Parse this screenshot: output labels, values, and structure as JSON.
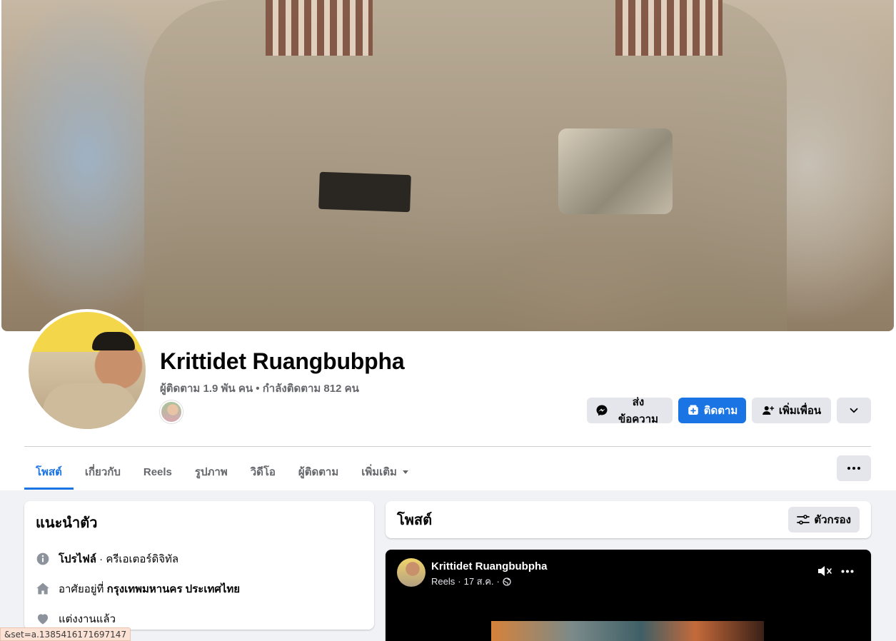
{
  "profile": {
    "name": "Krittidet Ruangbubpha",
    "stats": "ผู้ติดตาม 1.9 พัน คน • กำลังติดตาม 812 คน"
  },
  "actions": {
    "message": "ส่งข้อความ",
    "follow": "ติดตาม",
    "add_friend": "เพิ่มเพื่อน"
  },
  "tabs": [
    {
      "label": "โพสต์",
      "active": true
    },
    {
      "label": "เกี่ยวกับ"
    },
    {
      "label": "Reels"
    },
    {
      "label": "รูปภาพ"
    },
    {
      "label": "วิดีโอ"
    },
    {
      "label": "ผู้ติดตาม"
    },
    {
      "label": "เพิ่มเติม"
    }
  ],
  "intro": {
    "title": "แนะนำตัว",
    "profile_label": "โปรไฟล์",
    "profile_value": " · ครีเอเตอร์ดิจิทัล",
    "lives_prefix": "อาศัยอยู่ที่ ",
    "lives_value": "กรุงเทพมหานคร ประเทศไทย",
    "relationship": "แต่งงานแล้ว"
  },
  "posts": {
    "title": "โพสต์",
    "filter_label": "ตัวกรอง"
  },
  "reel_post": {
    "author": "Krittidet Ruangbubpha",
    "type": "Reels",
    "date": "17 ส.ค."
  },
  "status_bar": {
    "url": "&set=a.1385416171697147"
  },
  "colors": {
    "accent": "#1b74e4",
    "button_grey": "#e4e6eb",
    "secondary_text": "#65676b",
    "background": "#f0f2f5"
  },
  "icons": [
    "messenger-icon",
    "follow-icon",
    "add-friend-icon",
    "chevron-down-icon",
    "more-dots-icon",
    "info-icon",
    "home-icon",
    "heart-icon",
    "filter-icon",
    "mute-icon",
    "globe-icon"
  ]
}
